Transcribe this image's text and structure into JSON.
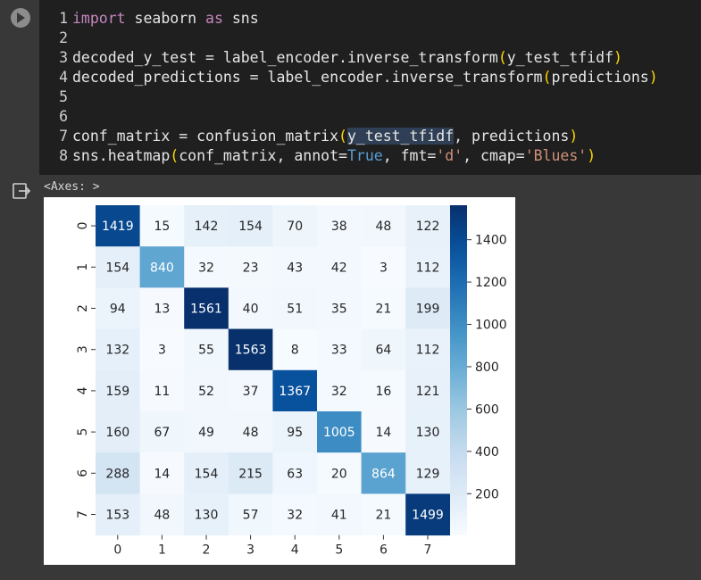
{
  "code_lines": [
    {
      "n": "1",
      "segments": [
        {
          "t": "import",
          "c": "kw"
        },
        {
          "t": " seaborn ",
          "c": ""
        },
        {
          "t": "as",
          "c": "kw"
        },
        {
          "t": " sns",
          "c": ""
        }
      ]
    },
    {
      "n": "2",
      "segments": []
    },
    {
      "n": "3",
      "segments": [
        {
          "t": "decoded_y_test = label_encoder.inverse_transform",
          "c": ""
        },
        {
          "t": "(",
          "c": "br"
        },
        {
          "t": "y_test_tfidf",
          "c": ""
        },
        {
          "t": ")",
          "c": "br"
        }
      ]
    },
    {
      "n": "4",
      "segments": [
        {
          "t": "decoded_predictions = label_encoder.inverse_transform",
          "c": ""
        },
        {
          "t": "(",
          "c": "br"
        },
        {
          "t": "predictions",
          "c": ""
        },
        {
          "t": ")",
          "c": "br"
        }
      ]
    },
    {
      "n": "5",
      "segments": []
    },
    {
      "n": "6",
      "segments": []
    },
    {
      "n": "7",
      "segments": [
        {
          "t": "conf_matrix = confusion_matrix",
          "c": ""
        },
        {
          "t": "(",
          "c": "br"
        },
        {
          "t": "y_test_tfidf",
          "c": "hl"
        },
        {
          "t": ", predictions",
          "c": ""
        },
        {
          "t": ")",
          "c": "br"
        }
      ]
    },
    {
      "n": "8",
      "segments": [
        {
          "t": "sns.heatmap",
          "c": ""
        },
        {
          "t": "(",
          "c": "br"
        },
        {
          "t": "conf_matrix, annot=",
          "c": ""
        },
        {
          "t": "True",
          "c": "tr"
        },
        {
          "t": ", fmt=",
          "c": ""
        },
        {
          "t": "'d'",
          "c": "st"
        },
        {
          "t": ", cmap=",
          "c": ""
        },
        {
          "t": "'Blues'",
          "c": "st"
        },
        {
          "t": ")",
          "c": "br"
        }
      ]
    }
  ],
  "output": {
    "axes_label": "<Axes: >"
  },
  "chart_data": {
    "type": "heatmap",
    "x_labels": [
      "0",
      "1",
      "2",
      "3",
      "4",
      "5",
      "6",
      "7"
    ],
    "y_labels": [
      "0",
      "1",
      "2",
      "3",
      "4",
      "5",
      "6",
      "7"
    ],
    "values": [
      [
        1419,
        15,
        142,
        154,
        70,
        38,
        48,
        122
      ],
      [
        154,
        840,
        32,
        23,
        43,
        42,
        3,
        112
      ],
      [
        94,
        13,
        1561,
        40,
        51,
        35,
        21,
        199
      ],
      [
        132,
        3,
        55,
        1563,
        8,
        33,
        64,
        112
      ],
      [
        159,
        11,
        52,
        37,
        1367,
        32,
        16,
        121
      ],
      [
        160,
        67,
        49,
        48,
        95,
        1005,
        14,
        130
      ],
      [
        288,
        14,
        154,
        215,
        63,
        20,
        864,
        129
      ],
      [
        153,
        48,
        130,
        57,
        32,
        41,
        21,
        1499
      ]
    ],
    "colormap": "Blues",
    "vmin": 3,
    "vmax": 1563,
    "colorbar_ticks": [
      200,
      400,
      600,
      800,
      1000,
      1200,
      1400
    ]
  }
}
